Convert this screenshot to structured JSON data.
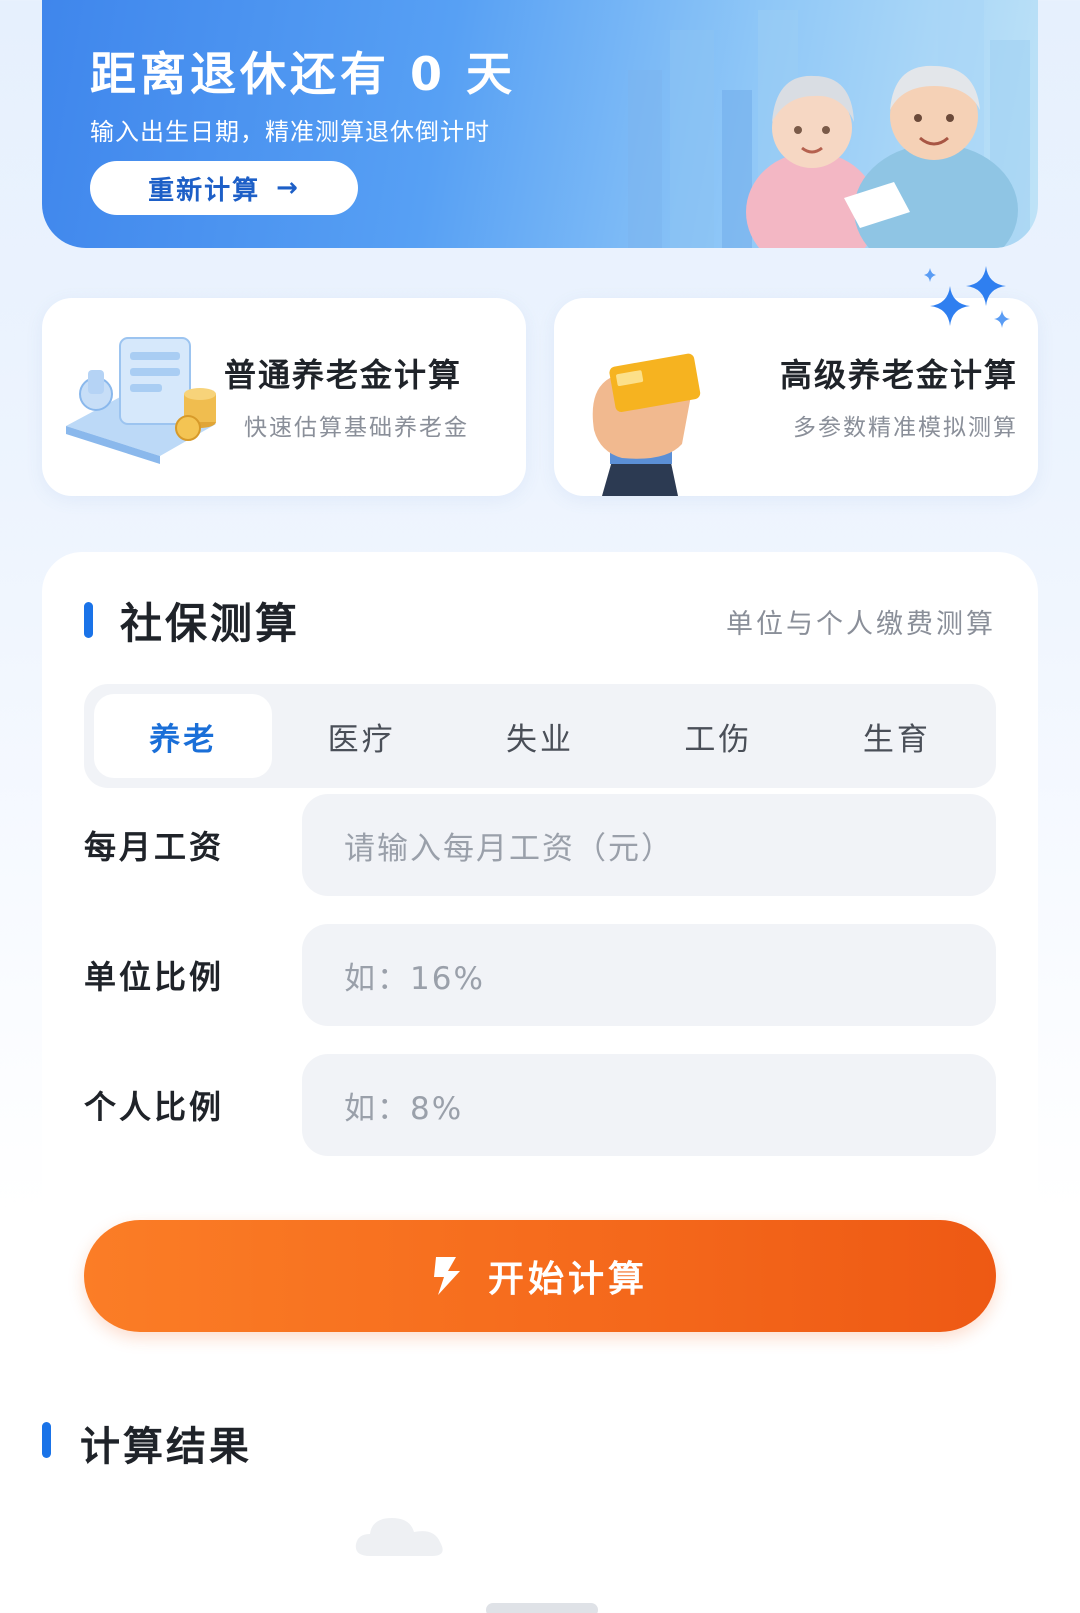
{
  "hero": {
    "title": "距离退休还有 0 天",
    "subtitle": "输入出生日期，精准测算退休倒计时",
    "button_label": "重新计算",
    "arrow_icon": "→"
  },
  "cards": [
    {
      "title": "普通养老金计算",
      "subtitle": "快速估算基础养老金",
      "icon": "calculator-coins-illustration"
    },
    {
      "title": "高级养老金计算",
      "subtitle": "多参数精准模拟测算",
      "icon": "hand-holding-gold-card-illustration"
    }
  ],
  "panel": {
    "title": "社保测算",
    "subtitle": "单位与个人缴费测算",
    "tabs": [
      {
        "label": "养老",
        "active": true
      },
      {
        "label": "医疗",
        "active": false
      },
      {
        "label": "失业",
        "active": false
      },
      {
        "label": "工伤",
        "active": false
      },
      {
        "label": "生育",
        "active": false
      }
    ],
    "fields": [
      {
        "label": "每月工资",
        "placeholder": "请输入每月工资（元）",
        "value": ""
      },
      {
        "label": "单位比例",
        "placeholder": "如：16%",
        "value": ""
      },
      {
        "label": "个人比例",
        "placeholder": "如：8%",
        "value": ""
      }
    ],
    "submit_label": "开始计算"
  },
  "result": {
    "title": "计算结果"
  },
  "colors": {
    "accent": "#1a73e8",
    "button_orange": "#f56a1c",
    "hero_blue": "#3f86ec"
  }
}
